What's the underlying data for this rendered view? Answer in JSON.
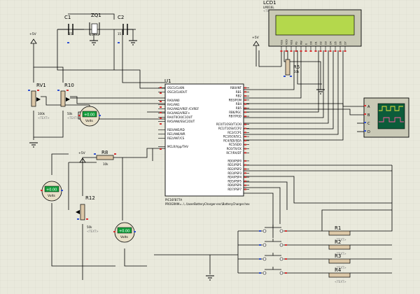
{
  "components": {
    "c1": {
      "ref": "C1",
      "value": "15"
    },
    "zq1": {
      "ref": "ZQ1",
      "value": "20MHz"
    },
    "c2": {
      "ref": "C2",
      "value": "15"
    },
    "rv1": {
      "ref": "RV1",
      "value": "100k"
    },
    "r10": {
      "ref": "R10",
      "value": "50k"
    },
    "r8": {
      "ref": "R8",
      "value": "10k"
    },
    "r12": {
      "ref": "R12",
      "value": "50k"
    },
    "r5": {
      "ref": "R5",
      "value": "10k"
    },
    "r1": {
      "ref": "R1"
    },
    "r2": {
      "ref": "R2"
    },
    "r3": {
      "ref": "R3"
    },
    "r4": {
      "ref": "R4"
    },
    "lcd": {
      "ref": "LCD1",
      "model": "LM016L"
    },
    "mcu": {
      "ref": "U1",
      "model": "PIC16F877A",
      "program_label": "PROGRAM=..\\..\\laserBatteryCharger-enc\\BatteryCharger.hex",
      "left_pins": [
        "OSC1/CLKIN",
        "OSC2/CLKOUT",
        "",
        "RA0/AN0",
        "RA1/AN1",
        "RA2/AN2/VREF-/CVREF",
        "RA3/AN3/VREF+",
        "RA4/T0CKI/C1OUT",
        "RA5/AN4/SS/C2OUT",
        "",
        "RE0/AN5/RD",
        "RE1/AN6/WR",
        "RE2/AN7/CS",
        "",
        "MCLR/Vpp/THV"
      ],
      "right_pins": [
        "RB0/INT",
        "RB1",
        "RB2",
        "RB3/PGM",
        "RB4",
        "RB5",
        "RB6/PGC",
        "RB7/PGD",
        "",
        "RC0/T1OSO/T1CKI",
        "RC1/T1OSI/CCP2",
        "RC2/CCP1",
        "RC3/SCK/SCL",
        "RC4/SDI/SDA",
        "RC5/SDO",
        "RC6/TX/CK",
        "RC7/RX/DT",
        "",
        "RD0/PSP0",
        "RD1/PSP1",
        "RD2/PSP2",
        "RD3/PSP3",
        "RD4/PSP4",
        "RD5/PSP5",
        "RD6/PSP6",
        "RD7/PSP7"
      ]
    }
  },
  "power": {
    "vcc_label": "+5V"
  },
  "tag_text": "<TEXT>",
  "voltmeter_unit": "Volts",
  "voltmeter_readings": [
    "+0.00",
    "+0.00",
    "+0.00"
  ],
  "lcd_pins": [
    "VSS",
    "VDD",
    "VEE",
    "RS",
    "RW",
    "E",
    "D0",
    "D1",
    "D2",
    "D3",
    "D4",
    "D5",
    "D6",
    "D7"
  ],
  "scope_channels": [
    "A",
    "B",
    "C",
    "D"
  ],
  "colors": {
    "background": "#e9e9dc",
    "grid": "#d9d9cb",
    "wire": "#000000",
    "lcd_screen": "#b4d84c",
    "pin_red": "#d83030",
    "pin_blue": "#3050d0",
    "component_body": "#dcc8a8",
    "meter_green": "#14a03c",
    "scope_screen": "#0c5c3a",
    "scope_trace": "#f0e63c"
  }
}
